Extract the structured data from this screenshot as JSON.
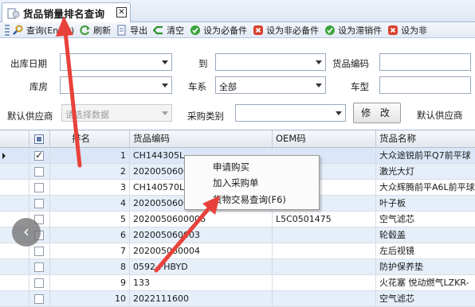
{
  "tab": {
    "title": "货品销量排名查询",
    "close": "✕"
  },
  "toolbar": {
    "query": "查询(Enter)",
    "refresh": "刷新",
    "export": "导出",
    "clear": "清空",
    "set_required": "设为必备件",
    "set_not_required": "设为非必备件",
    "set_slow": "设为滞销件",
    "set_not_slow": "设为非"
  },
  "form": {
    "out_date_label": "出库日期",
    "to_label": "到",
    "part_code_label": "货品编码",
    "warehouse_label": "库房",
    "series_label": "车系",
    "series_value": "全部",
    "model_label": "车型",
    "default_supplier_label": "默认供应商",
    "supplier_placeholder": "请选择数据",
    "purchase_type_label": "采购类别",
    "modify_button": "修 改",
    "default_supplier_col": "默认供应商"
  },
  "grid": {
    "columns": [
      "排名",
      "货品编码",
      "OEM码",
      "货品名称"
    ],
    "rows": [
      {
        "checked": true,
        "rank": "1",
        "code": "CH144305L",
        "oem": "",
        "name": "大众途锐前平Q7前平球"
      },
      {
        "checked": false,
        "rank": "2",
        "code": "2020050600",
        "oem": "",
        "name": "激光大灯"
      },
      {
        "checked": false,
        "rank": "3",
        "code": "CH140570L",
        "oem": "",
        "name": "大众辉腾前平A6L前平球"
      },
      {
        "checked": false,
        "rank": "4",
        "code": "2020050600",
        "oem": "",
        "name": "叶子板"
      },
      {
        "checked": false,
        "rank": "5",
        "code": "2020050600006",
        "oem": "L5C0501475",
        "name": "空气滤芯"
      },
      {
        "checked": false,
        "rank": "6",
        "code": "202005060003",
        "oem": "",
        "name": "轮毂盖"
      },
      {
        "checked": false,
        "rank": "7",
        "code": "202005060004",
        "oem": "",
        "name": "左后视镜"
      },
      {
        "checked": false,
        "rank": "8",
        "code": "0592-FHBYD",
        "oem": "",
        "name": "防护保养垫"
      },
      {
        "checked": false,
        "rank": "9",
        "code": "133",
        "oem": "",
        "name": "火花塞 悦动燃气LZKR-"
      },
      {
        "checked": false,
        "rank": "10",
        "code": "2022111600",
        "oem": "",
        "name": "空气滤芯"
      }
    ]
  },
  "context_menu": {
    "items": [
      "申请购买",
      "加入采购单",
      "货物交易查询(F6)"
    ]
  },
  "overlay": {
    "nav_glyph": "‹"
  },
  "colors": {
    "arrow": "#e8413b",
    "row_alt": "#e6eef9",
    "header_bg": "#e3e8ef"
  }
}
